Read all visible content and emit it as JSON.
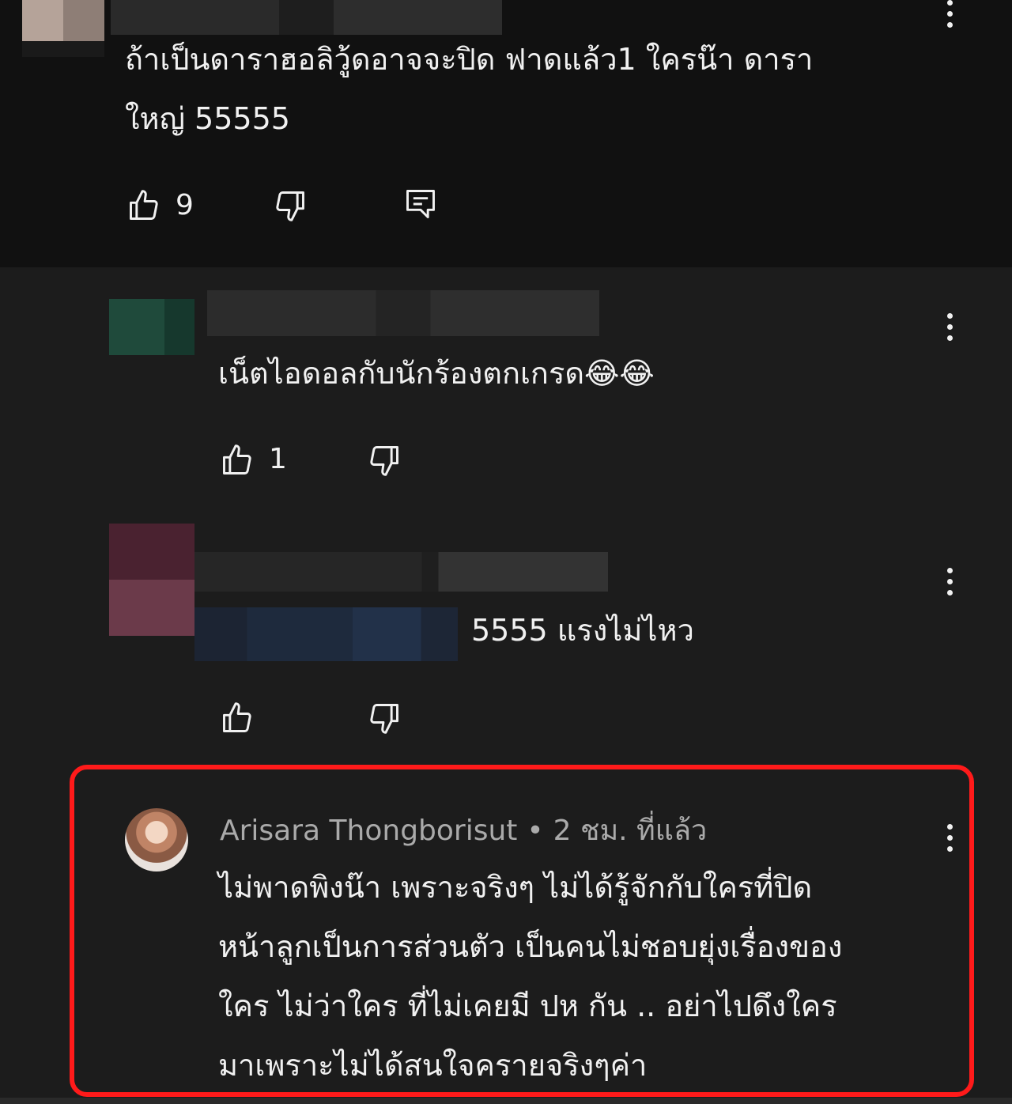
{
  "comments": [
    {
      "text_lines": [
        "ถ้าเป็นดาราฮอลิวู้ดอาจจะปิด ฟาดแล้ว1 ใครน๊า ดารา",
        "ใหญ่ 55555"
      ],
      "likes": "9",
      "icons": {
        "like": "thumb-up-icon",
        "dislike": "thumb-down-icon",
        "reply": "reply-comment-icon",
        "menu": "more-vertical-icon"
      }
    },
    {
      "text": "เน็ตไอดอลกับนักร้องตกเกรด😂😂",
      "likes": "1",
      "icons": {
        "like": "thumb-up-icon",
        "dislike": "thumb-down-icon",
        "menu": "more-vertical-icon"
      }
    },
    {
      "text": "5555 แรงไม่ไหว",
      "icons": {
        "like": "thumb-up-icon",
        "dislike": "thumb-down-icon",
        "menu": "more-vertical-icon"
      }
    },
    {
      "author": "Arisara Thongborisut",
      "separator": "•",
      "time": "2 ชม. ที่แล้ว",
      "text_lines": [
        "ไม่พาดพิงน๊า เพราะจริงๆ ไม่ได้รู้จักกับใครที่ปิด",
        "หน้าลูกเป็นการส่วนตัว เป็นคนไม่ชอบยุ่งเรื่องของ",
        "ใคร ไม่ว่าใคร ที่ไม่เคยมี ปห กัน .. อย่าไปดึงใคร",
        "มาเพราะไม่ได้สนใจครายจริงๆค่า"
      ],
      "icons": {
        "avatar": "avatar",
        "menu": "more-vertical-icon"
      }
    }
  ],
  "colors": {
    "top_background": "#111111",
    "background": "#1c1c1c",
    "text": "#f1f1f1",
    "meta_text": "#aaaaaa",
    "highlight": "#ff1a1a"
  }
}
